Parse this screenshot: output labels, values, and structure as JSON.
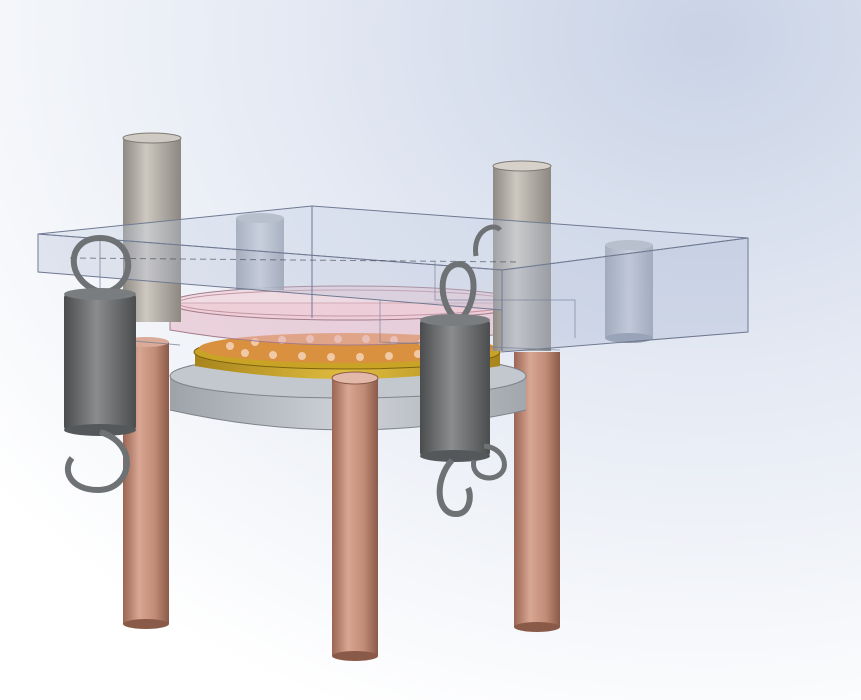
{
  "scene": {
    "kind": "cad-3d-assembly-render",
    "background": {
      "top_right": "#c9d3e6",
      "center": "#e4e9f3",
      "bottom": "#ffffff"
    },
    "parts": [
      {
        "name": "transparent-top-plate",
        "color": "#aebbd6"
      },
      {
        "name": "steel-guide-pins",
        "color": "#b2ada4",
        "count": 2
      },
      {
        "name": "steel-bushings",
        "color": "#aeb5c2",
        "count": 2
      },
      {
        "name": "copper-support-rods",
        "color": "#c4907c",
        "count": 3
      },
      {
        "name": "extension-springs",
        "color": "#6f7274",
        "count": 2
      },
      {
        "name": "translucent-pink-disc",
        "color": "#e6b6c4"
      },
      {
        "name": "orange-textured-layer",
        "color": "#d9903f"
      },
      {
        "name": "gold-ring",
        "color": "#c8a326"
      },
      {
        "name": "gray-base-disc",
        "color": "#b7bcc2"
      }
    ]
  }
}
